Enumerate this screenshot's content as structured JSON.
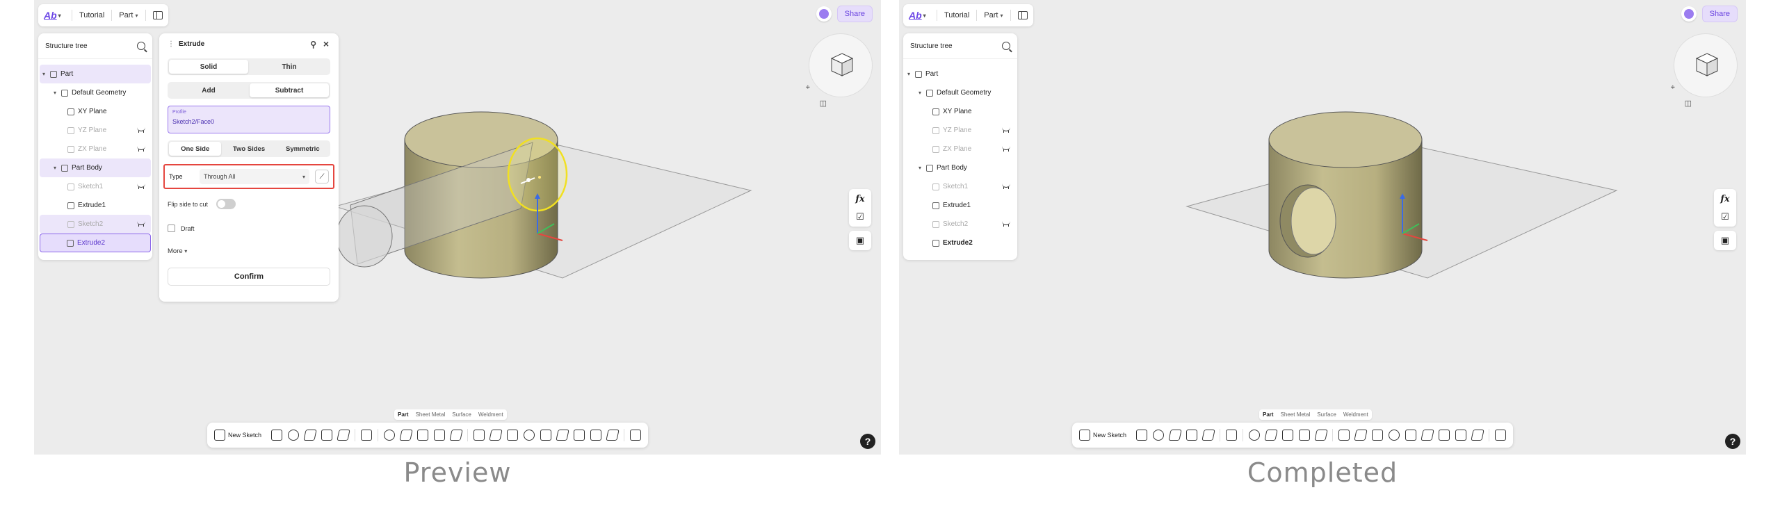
{
  "topbar": {
    "doc": "Tutorial",
    "mode": "Part",
    "share": "Share"
  },
  "tree": {
    "title": "Structure tree",
    "left_items": [
      {
        "label": "Part"
      },
      {
        "label": "Default Geometry"
      },
      {
        "label": "XY Plane"
      },
      {
        "label": "YZ Plane"
      },
      {
        "label": "ZX Plane"
      },
      {
        "label": "Part Body"
      },
      {
        "label": "Sketch1"
      },
      {
        "label": "Extrude1"
      },
      {
        "label": "Sketch2"
      },
      {
        "label": "Extrude2"
      }
    ],
    "right_items": [
      {
        "label": "Part"
      },
      {
        "label": "Default Geometry"
      },
      {
        "label": "XY Plane"
      },
      {
        "label": "YZ Plane"
      },
      {
        "label": "ZX Plane"
      },
      {
        "label": "Part Body"
      },
      {
        "label": "Sketch1"
      },
      {
        "label": "Extrude1"
      },
      {
        "label": "Sketch2"
      },
      {
        "label": "Extrude2"
      }
    ]
  },
  "extrude": {
    "title": "Extrude",
    "body_type": [
      "Solid",
      "Thin"
    ],
    "operation": [
      "Add",
      "Subtract"
    ],
    "profile_label": "Profile",
    "profile_value": "Sketch2/Face0",
    "direction": [
      "One Side",
      "Two Sides",
      "Symmetric"
    ],
    "type_label": "Type",
    "type_value": "Through All",
    "flip_label": "Flip side to cut",
    "draft_label": "Draft",
    "more_label": "More",
    "confirm_label": "Confirm"
  },
  "bottom": {
    "tabs": [
      "Part",
      "Sheet Metal",
      "Surface",
      "Weldment"
    ],
    "new_sketch": "New Sketch"
  },
  "help": "?",
  "captions": {
    "left": "Preview",
    "right": "Completed"
  },
  "colors": {
    "accent": "#6c47e6",
    "highlight_border": "#e5463f",
    "cylinder": "#c8c094"
  }
}
